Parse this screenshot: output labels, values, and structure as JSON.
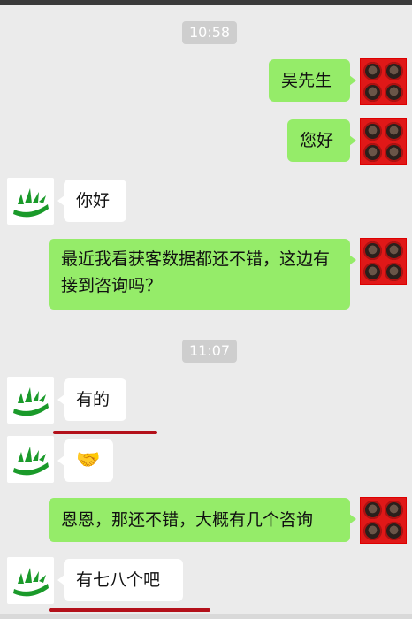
{
  "timestamps": [
    "10:58",
    "11:07"
  ],
  "messages": [
    {
      "side": "me",
      "text": "吴先生"
    },
    {
      "side": "me",
      "text": "您好"
    },
    {
      "side": "other",
      "text": "你好"
    },
    {
      "side": "me",
      "text": "最近我看获客数据都还不错，这边有接到咨询吗？"
    },
    {
      "side": "other",
      "text": "有的"
    },
    {
      "side": "other",
      "emoji": "🤝"
    },
    {
      "side": "me",
      "text": "恩恩，那还不错，大概有几个咨询"
    },
    {
      "side": "other",
      "text": "有七八个吧"
    }
  ],
  "highlight_color": "#b3101a"
}
